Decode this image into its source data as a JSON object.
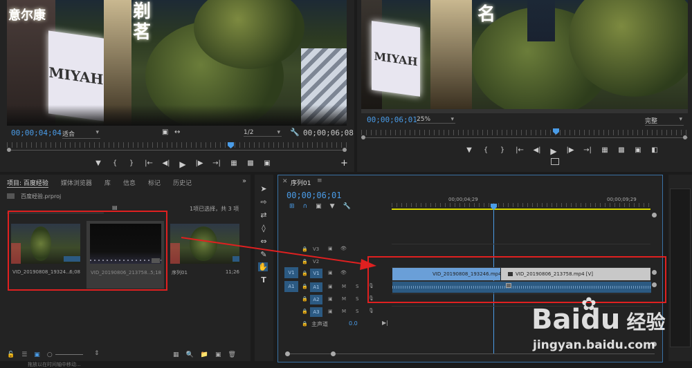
{
  "source_monitor": {
    "timecode_current": "00;00;04;04",
    "fit_label": "适合",
    "resolution_label": "1/2",
    "timecode_duration": "00;00;06;08",
    "sign_text_1": "意尔康",
    "sign_text_2": "MIYAH",
    "chinese_sign_chars": "剃 茗",
    "add_button": "+"
  },
  "program_monitor": {
    "timecode_current": "00;00;06;01",
    "zoom_label": "25%",
    "quality_label": "完整",
    "sign_text": "MIYAH",
    "chinese_sign_chars": "名"
  },
  "project_panel": {
    "tabs": [
      "项目: 百度经验",
      "媒体浏览器",
      "库",
      "信息",
      "标记",
      "历史记"
    ],
    "overflow": "»",
    "project_file": "百度经验.prproj",
    "selection_status": "1项已选择，共 3 项",
    "items": [
      {
        "name": "VID_20190808_19324...",
        "duration": "6;08"
      },
      {
        "name": "VID_20190806_213758...",
        "duration": "5;18"
      },
      {
        "name": "序列01",
        "duration": "11;26"
      }
    ]
  },
  "timeline": {
    "tab_label": "序列01",
    "timecode": "00;00;06;01",
    "ruler_marks": [
      "00;00;04;29",
      "00;00;09;29"
    ],
    "video_tracks": [
      "V3",
      "V2",
      "V1"
    ],
    "audio_tracks": [
      "A1",
      "A2",
      "A3"
    ],
    "master_label": "主声道",
    "master_value": "0.0",
    "source_v": "V1",
    "source_a": "A1",
    "clips": [
      {
        "label": "VID_20190808_193246.mp4 [V]"
      },
      {
        "label": "VID_20190806_213758.mp4 [V]"
      }
    ],
    "m_label": "M",
    "s_label": "S"
  },
  "status_bar": {
    "text": "拖放以在时间轴中移动..."
  },
  "watermark": {
    "brand": "Baidu",
    "brand_cn": "经验",
    "url": "jingyan.baidu.com"
  },
  "colors": {
    "accent_blue": "#4a9ce8",
    "clip_blue": "#6a9fd8",
    "clip_gray": "#c8c8c8",
    "annotation_red": "#e02020",
    "work_area_yellow": "#d8d800"
  }
}
